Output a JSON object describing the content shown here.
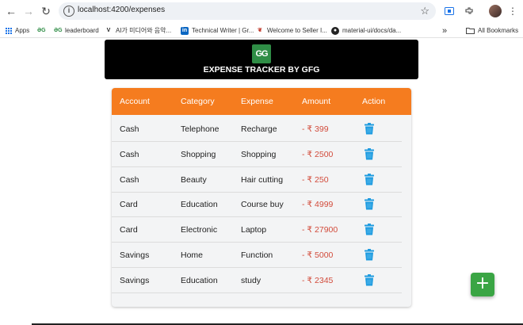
{
  "browser": {
    "url": "localhost:4200/expenses",
    "bookmarks": [
      {
        "label": "Apps",
        "icon": "apps-grid-icon"
      },
      {
        "label": "",
        "icon": "gfg-icon"
      },
      {
        "label": "leaderboard",
        "icon": "gfg-icon"
      },
      {
        "label": "AI가 미디어와 음악...",
        "icon": "vrew-icon"
      },
      {
        "label": "Technical Writer | Gr...",
        "icon": "linkedin-icon"
      },
      {
        "label": "Welcome to Seller I...",
        "icon": "seller-icon"
      },
      {
        "label": "material-ui/docs/da...",
        "icon": "github-icon"
      }
    ],
    "all_bookmarks": "All Bookmarks",
    "more": "»"
  },
  "header": {
    "logo_text": "GG",
    "title": "EXPENSE TRACKER BY GFG"
  },
  "table": {
    "columns": [
      "Account",
      "Category",
      "Expense",
      "Amount",
      "Action"
    ],
    "rows": [
      {
        "account": "Cash",
        "category": "Telephone",
        "expense": "Recharge",
        "amount": "- ₹ 399"
      },
      {
        "account": "Cash",
        "category": "Shopping",
        "expense": "Shopping",
        "amount": "- ₹ 2500"
      },
      {
        "account": "Cash",
        "category": "Beauty",
        "expense": "Hair cutting",
        "amount": "- ₹ 250"
      },
      {
        "account": "Card",
        "category": "Education",
        "expense": "Course buy",
        "amount": "- ₹ 4999"
      },
      {
        "account": "Card",
        "category": "Electronic",
        "expense": "Laptop",
        "amount": "- ₹ 27900"
      },
      {
        "account": "Savings",
        "category": "Home",
        "expense": "Function",
        "amount": "- ₹ 5000"
      },
      {
        "account": "Savings",
        "category": "Education",
        "expense": "study",
        "amount": "- ₹ 2345"
      }
    ]
  },
  "fab": {
    "label": "+"
  },
  "colors": {
    "header_bg": "#f57c1f",
    "amount": "#d24b3b",
    "trash": "#1e9be0",
    "fab": "#3aa544",
    "logo": "#2f8d46"
  }
}
